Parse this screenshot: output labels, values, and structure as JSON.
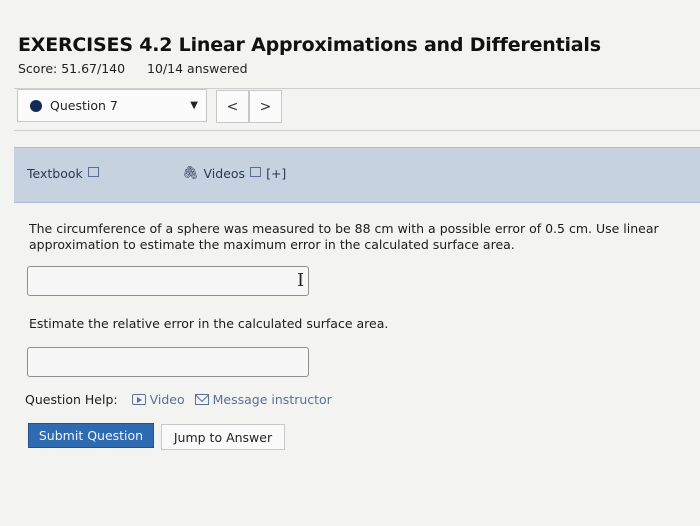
{
  "header": {
    "title": "EXERCISES 4.2 Linear Approximations and Differentials",
    "score": "Score: 51.67/140",
    "answered": "10/14 answered"
  },
  "question_nav": {
    "selected": "Question 7",
    "prev": "<",
    "next": ">"
  },
  "resources": {
    "textbook": "Textbook",
    "videos": "Videos",
    "expand": "[+]"
  },
  "question": {
    "part1": "The circumference of a sphere was measured to be 88 cm with a possible error of 0.5 cm. Use linear approximation to estimate the maximum error in the calculated surface area.",
    "answer1_value": "",
    "part2": "Estimate the relative error in the calculated surface area.",
    "answer2_value": ""
  },
  "help": {
    "label": "Question Help:",
    "video": "Video",
    "message": "Message instructor"
  },
  "buttons": {
    "submit": "Submit Question",
    "jump": "Jump to Answer"
  },
  "icons": {
    "status_dot": "filled-circle",
    "dropdown": "caret-down-icon",
    "external": "external-link-icon",
    "video": "play-icon",
    "mail": "mail-icon",
    "cursor": "text-cursor-icon"
  },
  "colors": {
    "resource_bar": "#c6d2e0",
    "submit_bg": "#2f6bb0",
    "link": "#5e6f96",
    "status_dot": "#132a55"
  }
}
